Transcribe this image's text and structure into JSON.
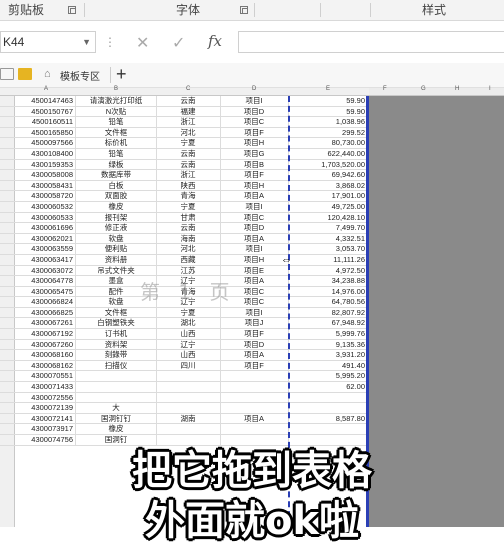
{
  "ribbon": {
    "group1": "剪贴板",
    "group2": "字体",
    "group3": "样式"
  },
  "formula_bar": {
    "name_box": "K44",
    "fx": "fx",
    "cancel_glyph": "✕",
    "confirm_glyph": "✓"
  },
  "tabs": {
    "template_tab": "模板专区",
    "add_tab": "+"
  },
  "columns": [
    "A",
    "B",
    "C",
    "D",
    "E",
    "F",
    "G",
    "H",
    "I"
  ],
  "rows": [
    {
      "a": "4500147463",
      "b": "请演激光打印纸",
      "c": "云南",
      "d": "项目I",
      "e": "59.90"
    },
    {
      "a": "4500150767",
      "b": "N次贴",
      "c": "福建",
      "d": "项目D",
      "e": "59.90"
    },
    {
      "a": "4500160511",
      "b": "铅笔",
      "c": "浙江",
      "d": "项目C",
      "e": "1,038.96"
    },
    {
      "a": "4500165850",
      "b": "文件框",
      "c": "河北",
      "d": "项目F",
      "e": "299.52"
    },
    {
      "a": "4500097566",
      "b": "标价机",
      "c": "宁夏",
      "d": "项目H",
      "e": "80,730.00"
    },
    {
      "a": "4300108400",
      "b": "铅笔",
      "c": "云南",
      "d": "项目G",
      "e": "622,440.00"
    },
    {
      "a": "4300159353",
      "b": "绿板",
      "c": "云南",
      "d": "项目B",
      "e": "1,703,520.00"
    },
    {
      "a": "4300058008",
      "b": "数据库带",
      "c": "浙江",
      "d": "项目F",
      "e": "69,942.60"
    },
    {
      "a": "4300058431",
      "b": "白板",
      "c": "陕西",
      "d": "项目H",
      "e": "3,868.02"
    },
    {
      "a": "4300058720",
      "b": "双面胶",
      "c": "青海",
      "d": "项目A",
      "e": "17,901.00"
    },
    {
      "a": "4300060532",
      "b": "橡皮",
      "c": "宁夏",
      "d": "项目I",
      "e": "49,725.00"
    },
    {
      "a": "4300060533",
      "b": "报刊架",
      "c": "甘肃",
      "d": "项目C",
      "e": "120,428.10"
    },
    {
      "a": "4300061696",
      "b": "修正液",
      "c": "云南",
      "d": "项目D",
      "e": "7,499.70"
    },
    {
      "a": "4300062021",
      "b": "软盘",
      "c": "海南",
      "d": "项目A",
      "e": "4,332.51"
    },
    {
      "a": "4300063559",
      "b": "便利贴",
      "c": "河北",
      "d": "项目I",
      "e": "3,053.70"
    },
    {
      "a": "4300063417",
      "b": "资料册",
      "c": "西藏",
      "d": "项目H",
      "e": "11,111.26"
    },
    {
      "a": "4300063072",
      "b": "吊式文件夹",
      "c": "江苏",
      "d": "项目E",
      "e": "4,972.50"
    },
    {
      "a": "4300064778",
      "b": "墨盒",
      "c": "辽宁",
      "d": "项目A",
      "e": "34,238.88"
    },
    {
      "a": "4300065475",
      "b": "配件",
      "c": "青海",
      "d": "项目C",
      "e": "14,976.00"
    },
    {
      "a": "4300066824",
      "b": "软盘",
      "c": "辽宁",
      "d": "项目C",
      "e": "64,780.56"
    },
    {
      "a": "4300066825",
      "b": "文件框",
      "c": "宁夏",
      "d": "项目I",
      "e": "82,807.92"
    },
    {
      "a": "4300067261",
      "b": "白钢塑铁夹",
      "c": "湖北",
      "d": "项目J",
      "e": "67,948.92"
    },
    {
      "a": "4300067192",
      "b": "订书机",
      "c": "山西",
      "d": "项目F",
      "e": "5,999.76"
    },
    {
      "a": "4300067260",
      "b": "资料架",
      "c": "辽宁",
      "d": "项目D",
      "e": "9,135.36"
    },
    {
      "a": "4300068160",
      "b": "刻錄带",
      "c": "山西",
      "d": "项目A",
      "e": "3,931.20"
    },
    {
      "a": "4300068162",
      "b": "扫描仪",
      "c": "四川",
      "d": "项目F",
      "e": "491.40"
    },
    {
      "a": "4300070551",
      "b": "",
      "c": "",
      "d": "",
      "e": "5,995.20"
    },
    {
      "a": "4300071433",
      "b": "",
      "c": "",
      "d": "",
      "e": "62.00"
    },
    {
      "a": "4300072556",
      "b": "",
      "c": "",
      "d": "",
      "e": ""
    },
    {
      "a": "4300072139",
      "b": "大",
      "c": "",
      "d": "",
      "e": ""
    },
    {
      "a": "4300072141",
      "b": "国洞钉钉",
      "c": "湖南",
      "d": "项目A",
      "e": "8,587.80"
    },
    {
      "a": "4300073917",
      "b": "橡皮",
      "c": "",
      "d": "",
      "e": ""
    },
    {
      "a": "4300074756",
      "b": "国洞钉",
      "c": "",
      "d": "",
      "e": ""
    }
  ],
  "page_watermark": "第 1 页",
  "subtitle": {
    "line1": "把它拖到表格",
    "line2": "外面就ok啦"
  }
}
